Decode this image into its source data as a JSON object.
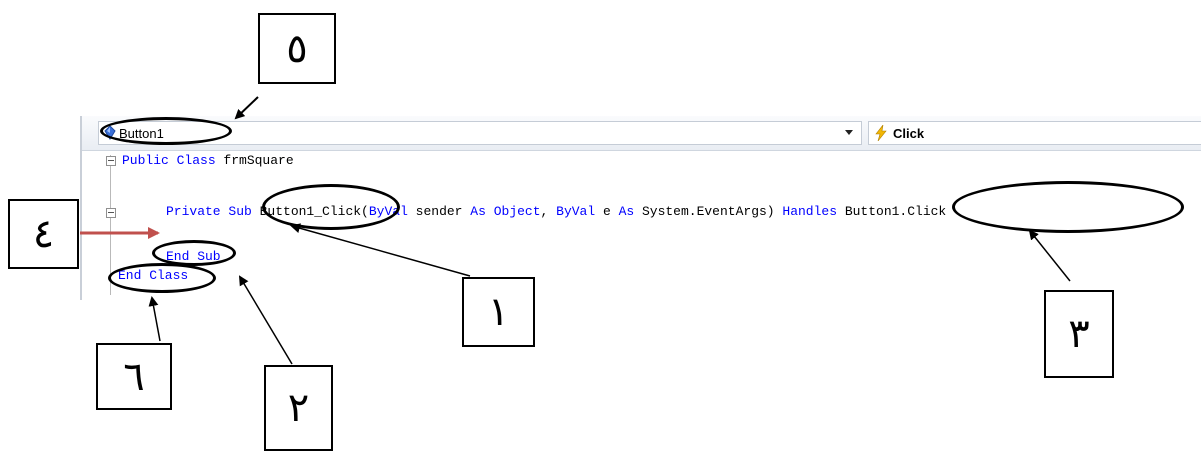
{
  "editor": {
    "object_combo": {
      "icon": "button-control-icon",
      "value": "Button1"
    },
    "event_combo": {
      "icon": "lightning-event-icon",
      "value": "Click"
    },
    "code": {
      "line1": {
        "kw": "Public Class",
        "rest": " frmSquare"
      },
      "line2": {
        "kw1": "Private Sub",
        "name": " Button1_Click(",
        "kw2": "ByVal",
        "p1": " sender ",
        "kw3": "As",
        "p2": " ",
        "kw4": "Object",
        "p3": ", ",
        "kw5": "ByVal",
        "p4": " e ",
        "kw6": "As",
        "p5": " System.EventArgs) ",
        "kw7": "Handles",
        "p6": " Button1.Click"
      },
      "line3": {
        "kw": "End Sub"
      },
      "line4": {
        "kw": "End Class"
      }
    }
  },
  "callouts": {
    "n1": "١",
    "n2": "٢",
    "n3": "٣",
    "n4": "٤",
    "n5": "٥",
    "n6": "٦"
  },
  "colors": {
    "keyword": "#0000ff",
    "arrow4": "#c0504d",
    "gutter_line": "#b9b9b9"
  }
}
